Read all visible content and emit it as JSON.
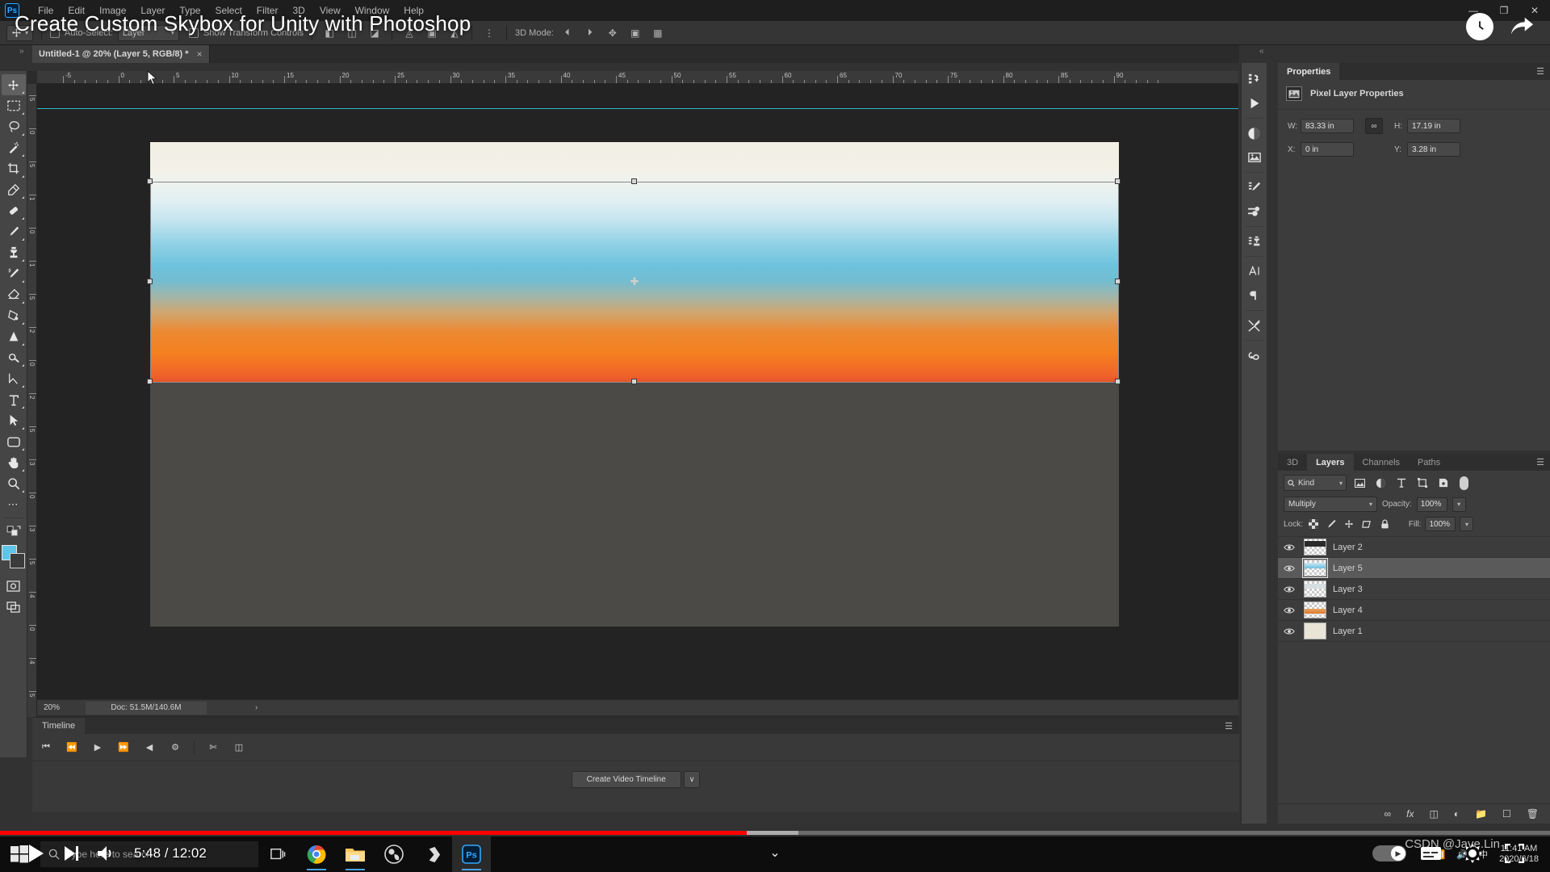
{
  "menubar": {
    "logo": "Ps",
    "items": [
      "File",
      "Edit",
      "Image",
      "Layer",
      "Type",
      "Select",
      "Filter",
      "3D",
      "View",
      "Window",
      "Help"
    ],
    "window_controls": [
      "minimize",
      "restore",
      "close"
    ]
  },
  "options_bar": {
    "tool_preset": "move-tool",
    "auto_select_label": "Auto-Select:",
    "auto_select_value": "Layer",
    "show_transform_label": "Show Transform Controls",
    "mode_3d_label": "3D Mode:"
  },
  "video_overlay": {
    "title": "Create Custom Skybox for Unity with Photoshop",
    "current_time": "5:48",
    "total_time": "12:02",
    "time_display": "5:48 / 12:02",
    "progress_percent": 48.2,
    "buffered_percent": 51.5,
    "watermark": "CSDN @Jave.Lin",
    "top_right_icons": [
      "history-clock-icon",
      "share-arrow-icon"
    ],
    "controls": [
      "play-icon",
      "next-track-icon",
      "volume-icon"
    ],
    "right_controls": [
      "autoplay-toggle",
      "subtitles-icon",
      "settings-gear-icon",
      "fullscreen-icon"
    ]
  },
  "document_tab": {
    "title": "Untitled-1 @ 20% (Layer 5, RGB/8) *",
    "close": "×"
  },
  "toolbar": {
    "tools": [
      {
        "name": "move-tool",
        "active": true
      },
      {
        "name": "rectangular-marquee-tool",
        "active": false
      },
      {
        "name": "lasso-tool",
        "active": false
      },
      {
        "name": "magic-wand-tool",
        "active": false
      },
      {
        "name": "crop-tool",
        "active": false
      },
      {
        "name": "eyedropper-tool",
        "active": false
      },
      {
        "name": "spot-healing-brush-tool",
        "active": false
      },
      {
        "name": "brush-tool",
        "active": false
      },
      {
        "name": "clone-stamp-tool",
        "active": false
      },
      {
        "name": "history-brush-tool",
        "active": false
      },
      {
        "name": "eraser-tool",
        "active": false
      },
      {
        "name": "gradient-tool",
        "active": false
      },
      {
        "name": "blur-tool",
        "active": false
      },
      {
        "name": "dodge-tool",
        "active": false
      },
      {
        "name": "pen-tool",
        "active": false
      },
      {
        "name": "type-tool",
        "active": false
      },
      {
        "name": "path-selection-tool",
        "active": false
      },
      {
        "name": "rectangle-tool",
        "active": false
      },
      {
        "name": "hand-tool",
        "active": false
      },
      {
        "name": "zoom-tool",
        "active": false
      },
      {
        "name": "edit-toolbar-tool",
        "active": false
      }
    ],
    "foreground_color": "#5ec5e8",
    "background_color": "#3b3b3b"
  },
  "canvas": {
    "zoom_label": "20%",
    "doc_info": "Doc: 51.5M/140.6M",
    "ruler_units": "inches",
    "ruler_h_labels": [
      "-5",
      "0",
      "5",
      "10",
      "15",
      "20",
      "25",
      "30",
      "35",
      "40",
      "45",
      "50",
      "55",
      "60",
      "65",
      "70",
      "75",
      "80",
      "85",
      "90"
    ],
    "ruler_v_labels": [
      "5",
      "0",
      "5",
      "1",
      "0",
      "1",
      "5",
      "2",
      "0",
      "2",
      "5",
      "3",
      "0",
      "3",
      "5",
      "4",
      "0",
      "4",
      "5"
    ],
    "guide_color": "#29b6c8",
    "sky_gradient_stops": [
      "#f2efe4",
      "#eef2ee",
      "#c7e6ef",
      "#6dc2dd",
      "#9fb6ac",
      "#ec8a34",
      "#e8542b"
    ]
  },
  "properties_panel": {
    "tabs": [
      {
        "label": "Properties",
        "active": true
      }
    ],
    "header": "Pixel Layer Properties",
    "fields": [
      {
        "label": "W:",
        "value": "83.33 in",
        "name": "width-field"
      },
      {
        "label": "H:",
        "value": "17.19 in",
        "name": "height-field"
      },
      {
        "label": "X:",
        "value": "0 in",
        "name": "x-position-field"
      },
      {
        "label": "Y:",
        "value": "3.28 in",
        "name": "y-position-field"
      }
    ],
    "link_label": "∞"
  },
  "layers_panel": {
    "tabs": [
      {
        "label": "3D",
        "active": false
      },
      {
        "label": "Layers",
        "active": true
      },
      {
        "label": "Channels",
        "active": false
      },
      {
        "label": "Paths",
        "active": false
      }
    ],
    "filter_kind": "Kind",
    "filter_icons": [
      "pixel-filter-icon",
      "adjustment-filter-icon",
      "type-filter-icon",
      "shape-filter-icon",
      "smart-object-filter-icon"
    ],
    "blend_mode": "Multiply",
    "opacity_label": "Opacity:",
    "opacity_value": "100%",
    "lock_label": "Lock:",
    "lock_icons": [
      "lock-transparent-pixels-icon",
      "lock-image-pixels-icon",
      "lock-position-icon",
      "lock-artboard-icon",
      "lock-all-icon"
    ],
    "fill_label": "Fill:",
    "fill_value": "100%",
    "layers": [
      {
        "name": "Layer 2",
        "visible": true,
        "selected": false,
        "thumb": "#2b2b2b"
      },
      {
        "name": "Layer 5",
        "visible": true,
        "selected": true,
        "thumb": "#7fc8e0"
      },
      {
        "name": "Layer 3",
        "visible": true,
        "selected": false,
        "thumb": "#cfd8dd"
      },
      {
        "name": "Layer 4",
        "visible": true,
        "selected": false,
        "thumb": "#e0883f"
      },
      {
        "name": "Layer 1",
        "visible": true,
        "selected": false,
        "thumb": "#e8e4d6"
      }
    ],
    "footer_icons": [
      "link-layers-icon",
      "layer-style-fx-icon",
      "add-mask-icon",
      "adjustment-layer-icon",
      "new-group-icon",
      "new-layer-icon",
      "delete-layer-icon"
    ]
  },
  "right_rail": {
    "icons": [
      "history-panel-icon",
      "actions-panel-icon",
      "adjustments-panel-icon",
      "libraries-panel-icon",
      "brush-settings-panel-icon",
      "brushes-panel-icon",
      "clone-source-panel-icon",
      "character-panel-icon",
      "paragraph-panel-icon",
      "tool-presets-panel-icon",
      "creative-cloud-icon"
    ]
  },
  "timeline_panel": {
    "tabs": [
      {
        "label": "Timeline",
        "active": true
      }
    ],
    "transport_icons": [
      "go-to-first-frame-icon",
      "previous-frame-icon",
      "play-icon",
      "next-frame-icon",
      "audio-icon",
      "settings-gear-icon",
      "split-clip-icon",
      "transition-icon"
    ],
    "create_button": "Create Video Timeline",
    "create_caret": "∨"
  },
  "taskbar": {
    "start_icon": "windows-start-icon",
    "search_placeholder": "Type here to search",
    "search_icon": "search-circle-icon",
    "apps": [
      "task-view-icon",
      "chrome-icon",
      "file-explorer-icon",
      "obs-studio-icon",
      "unity-icon",
      "photoshop-icon"
    ],
    "tray_time": "11:41 AM",
    "tray_date": "2020/6/18"
  }
}
